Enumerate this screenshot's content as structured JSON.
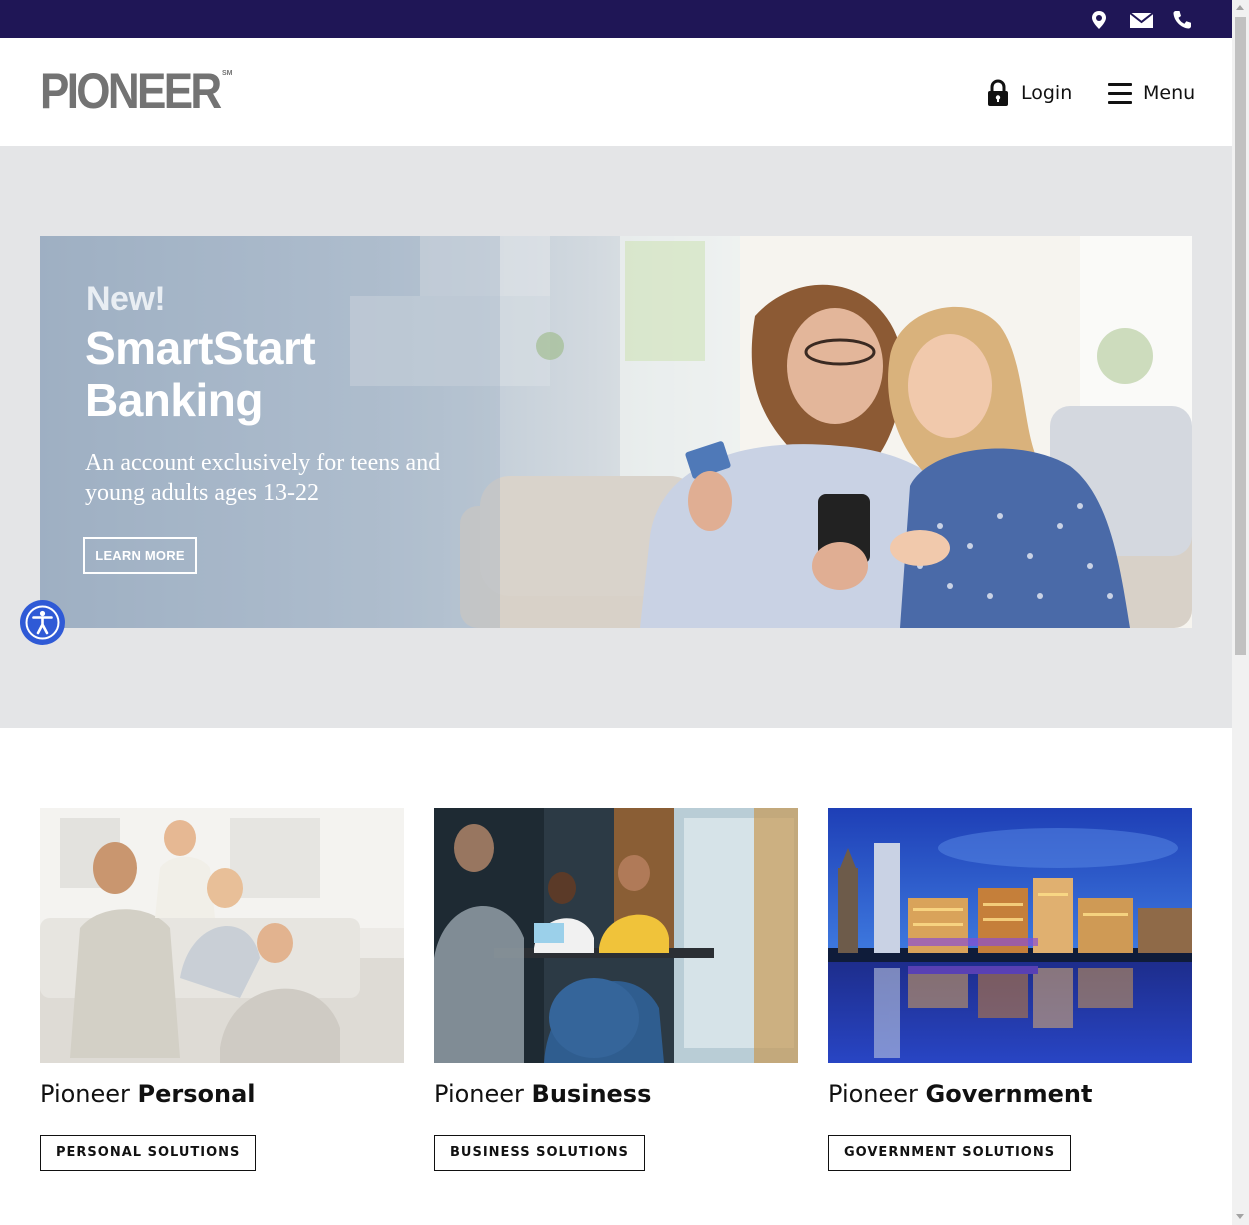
{
  "utility_bar": {
    "icons": [
      "location-pin-icon",
      "mail-icon",
      "phone-icon"
    ],
    "background": "#1f1656"
  },
  "header": {
    "logo_text": "PIONEER",
    "logo_tm": "SM",
    "login_label": "Login",
    "menu_label": "Menu"
  },
  "hero": {
    "eyebrow": "New!",
    "title": "SmartStart Banking",
    "subtitle": "An account exclusively for teens and young adults ages 13-22",
    "cta_label": "LEARN MORE"
  },
  "cards": [
    {
      "prefix": "Pioneer",
      "name": "Personal",
      "button_label": "PERSONAL SOLUTIONS"
    },
    {
      "prefix": "Pioneer",
      "name": "Business",
      "button_label": "BUSINESS SOLUTIONS"
    },
    {
      "prefix": "Pioneer",
      "name": "Government",
      "button_label": "GOVERNMENT SOLUTIONS"
    }
  ],
  "colors": {
    "brand_navy": "#1f1656",
    "logo_gray": "#737373",
    "hero_band": "#e4e5e7",
    "accessibility_blue": "#2f5ad6"
  }
}
